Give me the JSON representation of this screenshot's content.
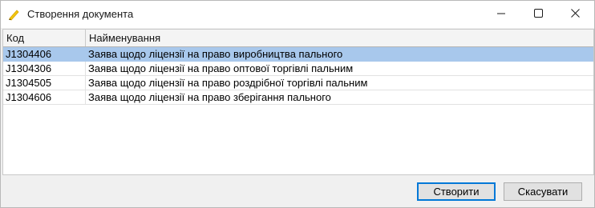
{
  "window": {
    "title": "Створення документа",
    "icon": "pen-icon",
    "controls": [
      "minimize-icon",
      "maximize-icon",
      "close-icon"
    ]
  },
  "table": {
    "columns": [
      "Код",
      "Найменування"
    ],
    "selected_row": 0,
    "rows": [
      {
        "code": "J1304406",
        "name": "Заява щодо ліцензії на право виробництва пального"
      },
      {
        "code": "J1304306",
        "name": "Заява щодо ліцензії на право оптової торгівлі пальним"
      },
      {
        "code": "J1304505",
        "name": "Заява щодо ліцензії на право роздрібної торгівлі пальним"
      },
      {
        "code": "J1304606",
        "name": "Заява щодо ліцензії на право зберігання пального"
      }
    ]
  },
  "buttons": {
    "create": "Створити",
    "cancel": "Скасувати"
  },
  "colors": {
    "selection": "#a8c8ec",
    "default_button_border": "#0078d7",
    "pen_icon": "#f2c811"
  }
}
